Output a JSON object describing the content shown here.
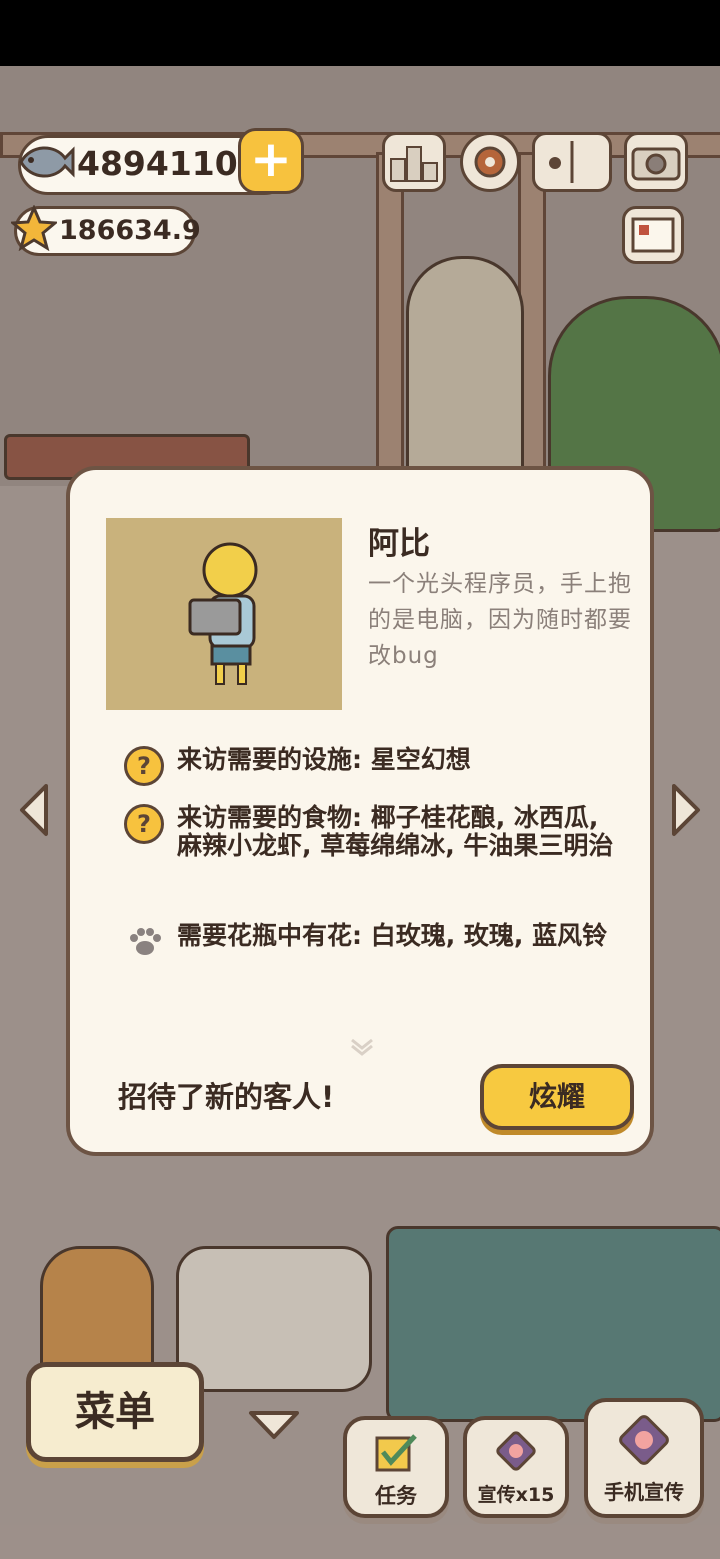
{
  "hud": {
    "fish_count": "4894110",
    "star_count": "186634.9",
    "plus_label": "+"
  },
  "dialog": {
    "character_name": "阿比",
    "character_desc": "一个光头程序员，手上抱的是电脑，因为随时都要改bug",
    "requirements": [
      {
        "icon": "question-icon",
        "text": "来访需要的设施: 星空幻想"
      },
      {
        "icon": "question-icon",
        "text": "来访需要的食物: 椰子桂花酿, 冰西瓜, 麻辣小龙虾, 草莓绵绵冰, 牛油果三明治"
      },
      {
        "icon": "paw-icon",
        "text": "需要花瓶中有花: 白玫瑰, 玫瑰, 蓝风铃"
      }
    ],
    "footer_text": "招待了新的客人!",
    "share_label": "炫耀"
  },
  "bottom_bar": {
    "menu_label": "菜单",
    "tasks_label": "任务",
    "promo_label": "宣传x15",
    "phone_promo_label": "手机宣传"
  },
  "colors": {
    "accent": "#f7c940",
    "outline": "#5c4536",
    "panel": "#fbf6ec"
  }
}
